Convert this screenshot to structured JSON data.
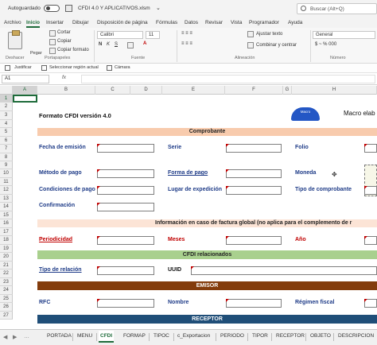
{
  "titlebar": {
    "autosave": "Autoguardado",
    "filename": "CFDI 4.0 Y APLICATIVOS.xlsm",
    "search_placeholder": "Buscar (Alt+Q)"
  },
  "ribbon_tabs": [
    "Archivo",
    "Inicio",
    "Insertar",
    "Dibujar",
    "Disposición de página",
    "Fórmulas",
    "Datos",
    "Revisar",
    "Vista",
    "Programador",
    "Ayuda"
  ],
  "ribbon": {
    "cut": "Cortar",
    "copy": "Copiar",
    "paste": "Pegar",
    "format_painter": "Copiar formato",
    "font_name": "Calibri",
    "font_size": "11",
    "wrap_text": "Ajustar texto",
    "merge_center": "Combinar y centrar",
    "number_format": "General",
    "groups": {
      "undo": "Deshacer",
      "clipboard": "Portapapeles",
      "font": "Fuente",
      "alignment": "Alineación",
      "number": "Número"
    }
  },
  "quickbar": {
    "justify": "Justificar",
    "select_region": "Seleccionar región actual",
    "camera": "Cámara"
  },
  "formula_bar": {
    "namebox": "A1",
    "fx": "fx"
  },
  "columns": [
    "A",
    "B",
    "C",
    "D",
    "E",
    "F",
    "G",
    "H"
  ],
  "rows": [
    "1",
    "2",
    "3",
    "4",
    "5",
    "6",
    "7",
    "8",
    "9",
    "10",
    "11",
    "12",
    "13",
    "14",
    "15",
    "16",
    "17",
    "18",
    "19",
    "20",
    "21",
    "22",
    "23",
    "24",
    "25",
    "26",
    "27"
  ],
  "sheet": {
    "title": "Formato CFDI versión 4.0",
    "macro_text": "Macro elab",
    "logo_text": "Macro",
    "bands": {
      "comprobante": "Comprobante",
      "global": "Información en caso de factura global (no aplica para el complemento de r",
      "relacionados": "CFDI relacionados",
      "emisor": "EMISOR",
      "receptor": "RECEPTOR"
    },
    "labels": {
      "fecha": "Fecha de emisión",
      "serie": "Serie",
      "folio": "Folio",
      "metodo": "Método de pago",
      "forma": "Forma de pago",
      "moneda": "Moneda",
      "condiciones": "Condiciones de pago",
      "lugar": "Lugar de expedición",
      "tipo_comprobante": "Tipo de comprobante",
      "confirmacion": "Confirmación",
      "periodicidad": "Periodicidad",
      "meses": "Meses",
      "anio": "Año",
      "tipo_relacion": "Tipo de relación",
      "uuid": "UUID",
      "rfc": "RFC",
      "nombre": "Nombre",
      "regimen": "Régimen fiscal"
    }
  },
  "sheet_tabs": [
    "PORTADA",
    "MENU",
    "CFDI",
    "FORMAP",
    "TIPOC",
    "c_Exportacion",
    "PERIODO",
    "TIPOR",
    "RECEPTOR",
    "OBJETO",
    "DESCRIPCION"
  ],
  "colors": {
    "comprobante": "#f8cbad",
    "global": "#fce4d6",
    "relacionados": "#a9d08e",
    "emisor": "#833c0c",
    "receptor": "#1f4e78",
    "accent": "#1e6b3a"
  }
}
